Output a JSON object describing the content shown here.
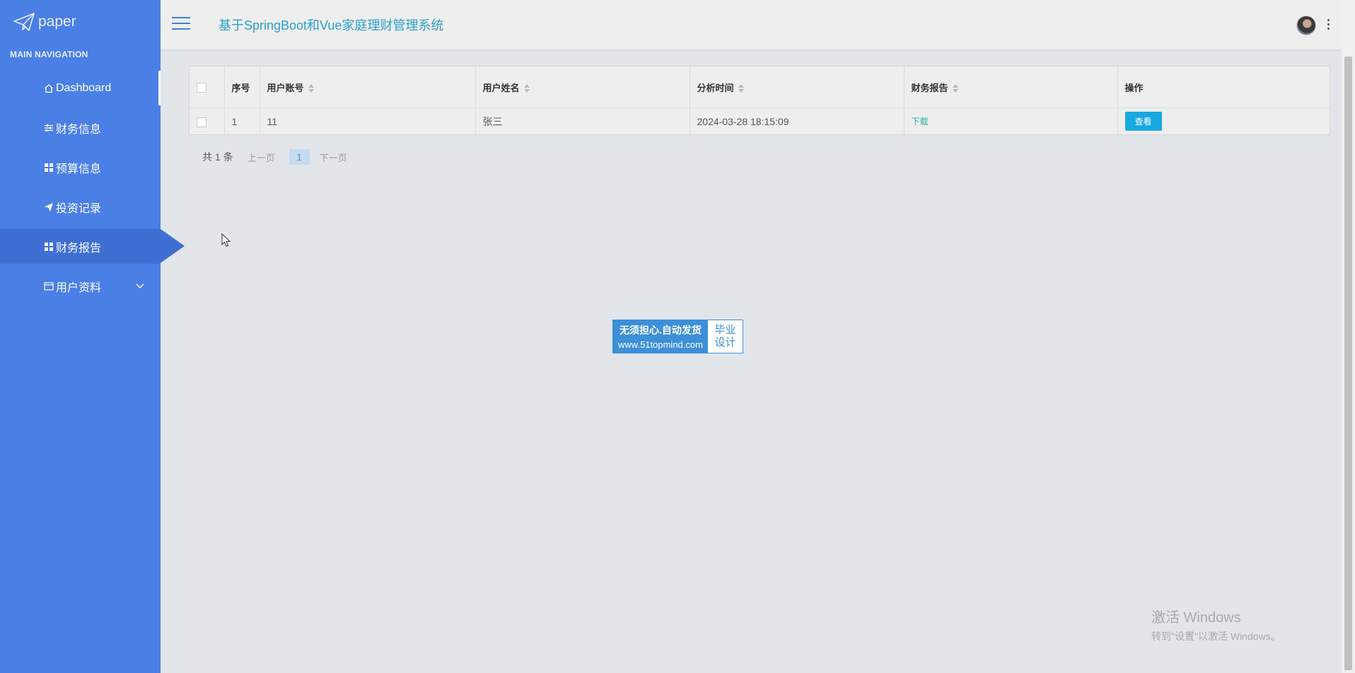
{
  "sidebar": {
    "brand": "paper",
    "heading": "MAIN NAVIGATION",
    "items": [
      {
        "label": "Dashboard",
        "icon": "home-icon"
      },
      {
        "label": "财务信息",
        "icon": "sliders-icon"
      },
      {
        "label": "预算信息",
        "icon": "grid-icon"
      },
      {
        "label": "投资记录",
        "icon": "send-icon"
      },
      {
        "label": "财务报告",
        "icon": "grid-icon",
        "active": true
      },
      {
        "label": "用户资料",
        "icon": "card-icon",
        "expandable": true
      }
    ]
  },
  "header": {
    "title": "基于SpringBoot和Vue家庭理财管理系统"
  },
  "table": {
    "columns": [
      "序号",
      "用户账号",
      "用户姓名",
      "分析时间",
      "财务报告",
      "操作"
    ],
    "rows": [
      {
        "index": "1",
        "account": "11",
        "name": "张三",
        "time": "2024-03-28 18:15:09",
        "report": "下载",
        "action": "查看"
      }
    ]
  },
  "pagination": {
    "total": "共 1 条",
    "prev": "上一页",
    "page": "1",
    "next": "下一页"
  },
  "badge": {
    "line1": "无须担心.自动发货",
    "line2": "www.51topmind.com",
    "right1": "毕业",
    "right2": "设计"
  },
  "windows": {
    "line1": "激活 Windows",
    "line2": "转到\"设置\"以激活 Windows。"
  },
  "colors": {
    "sidebar": "#4a7fe6",
    "sidebar_active": "#3f6fd3",
    "accent": "#18a9e0",
    "title": "#2aa0c8"
  }
}
